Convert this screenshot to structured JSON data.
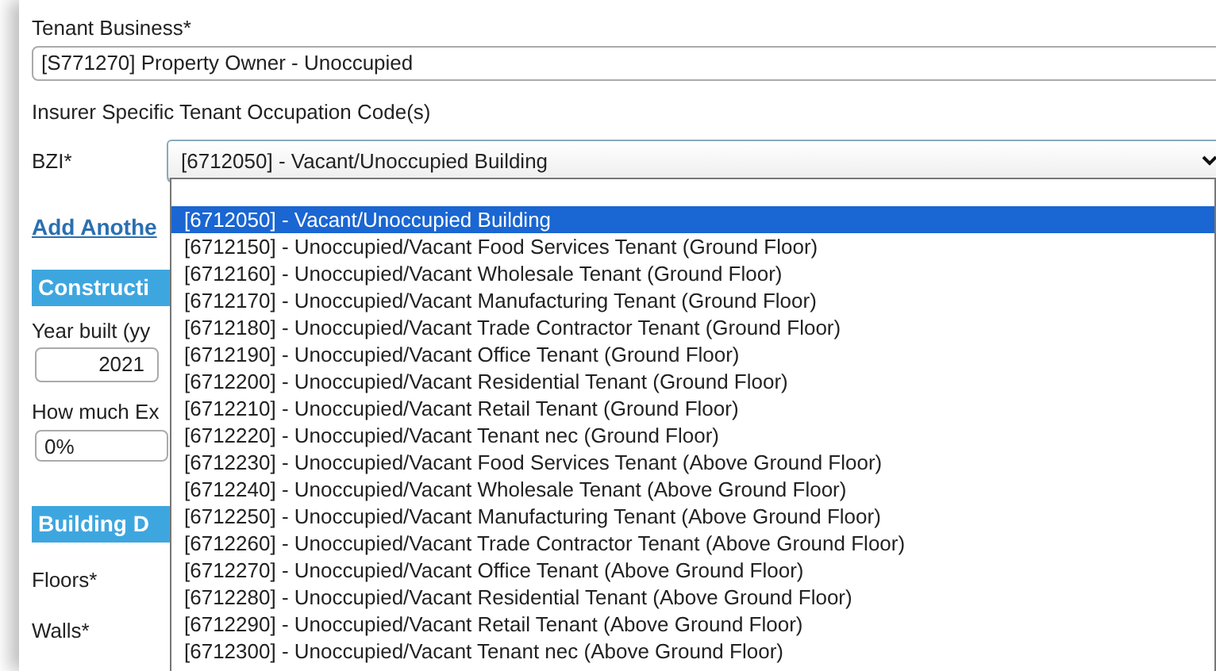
{
  "tenant_business": {
    "label": "Tenant Business*",
    "value": "[S771270] Property Owner - Unoccupied"
  },
  "occupation_codes": {
    "heading": "Insurer Specific Tenant Occupation Code(s)",
    "label": "BZI*",
    "value": "[6712050] - Vacant/Unoccupied Building"
  },
  "add_another": "Add Anothe",
  "construction": {
    "heading": "Constructi",
    "year_label": "Year built (yy",
    "year_value": "2021",
    "extent_label": "How much Ex",
    "extent_value": "0%"
  },
  "building": {
    "heading": "Building D",
    "fields": [
      "Floors*",
      "Walls*"
    ]
  },
  "dropdown": {
    "options": [
      {
        "label": "[6712050] - Vacant/Unoccupied Building",
        "selected": true
      },
      {
        "label": "[6712150] - Unoccupied/Vacant Food Services Tenant (Ground Floor)",
        "selected": false
      },
      {
        "label": "[6712160] - Unoccupied/Vacant Wholesale Tenant (Ground Floor)",
        "selected": false
      },
      {
        "label": "[6712170] - Unoccupied/Vacant Manufacturing Tenant (Ground Floor)",
        "selected": false
      },
      {
        "label": "[6712180] - Unoccupied/Vacant Trade Contractor Tenant (Ground Floor)",
        "selected": false
      },
      {
        "label": "[6712190] - Unoccupied/Vacant Office Tenant (Ground Floor)",
        "selected": false
      },
      {
        "label": "[6712200] - Unoccupied/Vacant Residential Tenant (Ground Floor)",
        "selected": false
      },
      {
        "label": "[6712210] - Unoccupied/Vacant Retail Tenant (Ground Floor)",
        "selected": false
      },
      {
        "label": "[6712220] - Unoccupied/Vacant Tenant nec (Ground Floor)",
        "selected": false
      },
      {
        "label": "[6712230] - Unoccupied/Vacant Food Services Tenant (Above Ground Floor)",
        "selected": false
      },
      {
        "label": "[6712240] - Unoccupied/Vacant Wholesale Tenant (Above Ground Floor)",
        "selected": false
      },
      {
        "label": "[6712250] - Unoccupied/Vacant Manufacturing Tenant (Above Ground Floor)",
        "selected": false
      },
      {
        "label": "[6712260] - Unoccupied/Vacant Trade Contractor Tenant (Above Ground Floor)",
        "selected": false
      },
      {
        "label": "[6712270] - Unoccupied/Vacant Office Tenant (Above Ground Floor)",
        "selected": false
      },
      {
        "label": "[6712280] - Unoccupied/Vacant Residential Tenant (Above Ground Floor)",
        "selected": false
      },
      {
        "label": "[6712290] - Unoccupied/Vacant Retail Tenant (Above Ground Floor)",
        "selected": false
      },
      {
        "label": "[6712300] - Unoccupied/Vacant Tenant nec (Above Ground Floor)",
        "selected": false
      }
    ]
  }
}
